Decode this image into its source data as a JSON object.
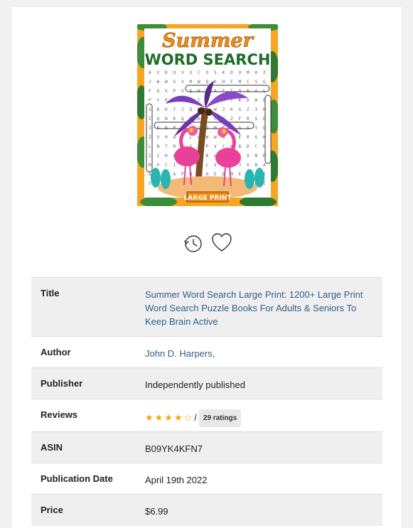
{
  "cover": {
    "alt": "Summer Word Search Large Print book cover",
    "title_line1": "Summer",
    "title_line2": "WORD SEARCH",
    "badge": "LARGE PRINT",
    "puzzle_rows": [
      "AVBUVUCOSKDOMHZ",
      "JWWSVMWQKHFMCSG",
      "FQXPSENSATIONAL",
      "PYRSJSTEMMYKDWE",
      "SBKYJQWOWJKGZIK",
      "IQNKQEDPCJZFRSD",
      "ZRBPCJLQMDBGSYD",
      "ZSHALLOWWATERSK",
      "LNTRQGOPVCKBDCN",
      "IIHAVXQBLOTIONR",
      "NVCIFZFLVLTJGNA",
      "GJWAPMJHEDMENHI",
      "SSVUJLZEDSASRGI"
    ],
    "colors": {
      "title_orange": "#f08c16",
      "title_green": "#1f6b2a",
      "background_orange": "#f6a623",
      "leaf_green": "#3c8d3a",
      "flamingo_pink": "#e9409a",
      "palm_purple": "#7b3fb8",
      "sand": "#f2b977",
      "flipflop_teal": "#2ab5b0"
    }
  },
  "actions": {
    "history_icon": "clock-history-icon",
    "favorite_icon": "heart-outline-icon"
  },
  "details": {
    "title_label": "Title",
    "title_value": "Summer Word Search Large Print: 1200+ Large Print Word Search Puzzle Books For Adults & Seniors To Keep Brain Active",
    "author_label": "Author",
    "author_value": "John D. Harpers,",
    "publisher_label": "Publisher",
    "publisher_value": "Independently published",
    "reviews_label": "Reviews",
    "reviews_stars": "★★★★☆",
    "reviews_rating": 4,
    "reviews_separator": "/",
    "reviews_count": "29 ratings",
    "asin_label": "ASIN",
    "asin_value": "B09YK4KFN7",
    "pubdate_label": "Publication Date",
    "pubdate_value": "April 19th 2022",
    "price_label": "Price",
    "price_value": "$6.99"
  },
  "colors": {
    "link": "#2f6089",
    "star": "#f0a800",
    "row_shade": "#efefef",
    "page_bg": "#f1f1f1"
  }
}
